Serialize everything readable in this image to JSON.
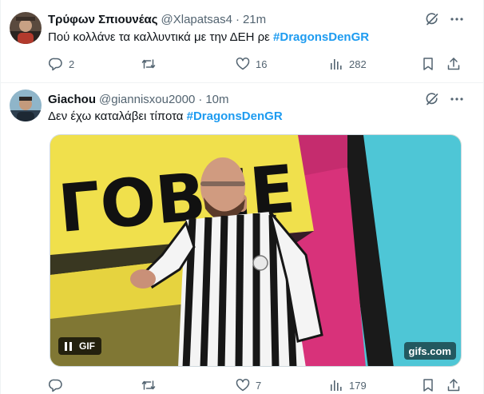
{
  "tweets": [
    {
      "author": {
        "display_name": "Τρύφων Σπιουνέας",
        "handle": "@Xlapatsas4"
      },
      "time": "21m",
      "text_prefix": "Πού κολλάνε τα καλλυντικά με την ΔΕΗ ρε ",
      "hashtag": "#DragonsDenGR",
      "stats": {
        "replies": "2",
        "reposts": "",
        "likes": "16",
        "views": "282"
      }
    },
    {
      "author": {
        "display_name": "Giachou",
        "handle": "@giannisxou2000"
      },
      "time": "10m",
      "text_prefix": "Δεν έχω καταλάβει τίποτα ",
      "hashtag": "#DragonsDenGR",
      "media": {
        "type": "gif",
        "badge": "GIF",
        "source": "gifs.com",
        "banner_text": "ΓΟΒΕΕ"
      },
      "stats": {
        "replies": "",
        "reposts": "",
        "likes": "7",
        "views": "179"
      }
    }
  ],
  "separator": "·",
  "icons": [
    "grok-icon",
    "more-icon",
    "reply-icon",
    "repost-icon",
    "like-icon",
    "views-icon",
    "bookmark-icon",
    "share-icon",
    "pause-icon"
  ],
  "colors": {
    "hashtag": "#1d9bf0",
    "secondary_text": "#536471",
    "divider": "#eff3f4"
  }
}
